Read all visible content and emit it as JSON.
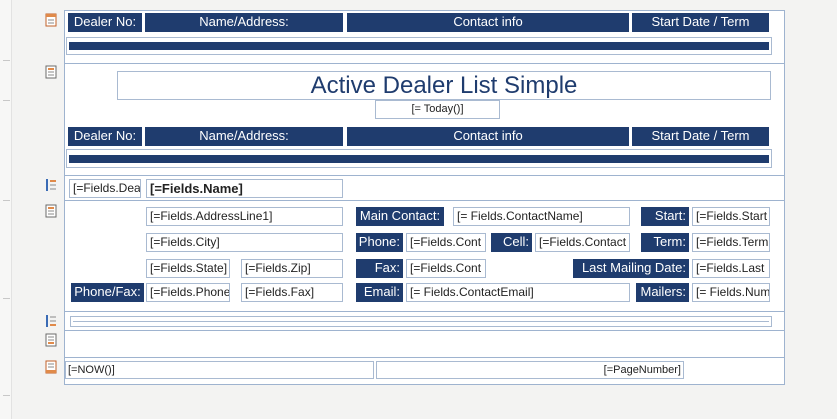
{
  "header_labels": {
    "dealer_no": "Dealer No:",
    "name_address": "Name/Address:",
    "contact_info": "Contact info",
    "start_date_term": "Start Date / Term"
  },
  "report": {
    "title": "Active Dealer List Simple",
    "date_expr": "[= Today()]"
  },
  "group_header": {
    "dealer_field": "[=Fields.Dea",
    "name_field": "[=Fields.Name]"
  },
  "detail": {
    "address_line1": "[=Fields.AddressLine1]",
    "city": "[=Fields.City]",
    "state": "[=Fields.State]",
    "zip": "[=Fields.Zip]",
    "phone_fax_label": "Phone/Fax:",
    "phone": "[=Fields.Phone",
    "fax": "[=Fields.Fax]",
    "main_contact_label": "Main Contact:",
    "contact_name": "[= Fields.ContactName]",
    "phone_label": "Phone:",
    "contact_phone": "[=Fields.Cont",
    "cell_label": "Cell:",
    "contact_cell": "[=Fields.Contact",
    "fax_label": "Fax:",
    "contact_fax": "[=Fields.Cont",
    "email_label": "Email:",
    "contact_email": "[= Fields.ContactEmail]",
    "start_label": "Start:",
    "start_value": "[=Fields.Start",
    "term_label": "Term:",
    "term_value": "[=Fields.Term",
    "last_mailing_label": "Last Mailing Date:",
    "last_mailing_value": "[=Fields.Last",
    "mailers_label": "Mailers:",
    "mailers_value": "[= Fields.Num"
  },
  "page_footer": {
    "now_expr": "[=NOW()]",
    "page_number_expr": "[=PageNumber]"
  },
  "colors": {
    "accent": "#1f3c6e",
    "border": "#9eb3cf"
  },
  "icons": {
    "page_header_section": "page-header-icon",
    "report_header_section": "report-header-icon",
    "group_header_section": "group-header-icon",
    "detail_section": "detail-icon",
    "group_footer_section": "group-footer-icon",
    "report_footer_section": "report-footer-icon",
    "page_footer_section": "page-footer-icon"
  }
}
